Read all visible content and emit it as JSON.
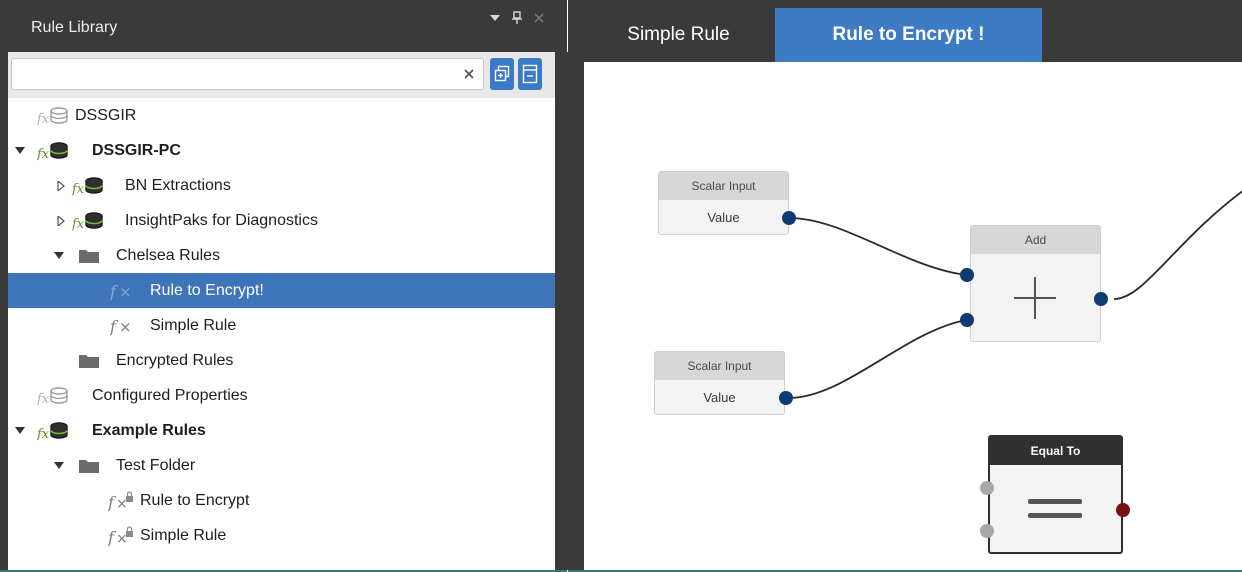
{
  "library": {
    "title": "Rule Library",
    "search": {
      "value": "",
      "placeholder": ""
    },
    "tree": [
      {
        "label": "DSSGIR",
        "icon": "function-database-icon",
        "bold": false
      },
      {
        "label": "DSSGIR-PC",
        "icon": "function-database-icon",
        "bold": true,
        "expanded": true
      },
      {
        "label": "BN Extractions",
        "icon": "function-database-icon",
        "bold": false,
        "expanded": false
      },
      {
        "label": "InsightPaks for Diagnostics",
        "icon": "function-database-icon",
        "bold": false,
        "expanded": false
      },
      {
        "label": "Chelsea Rules",
        "icon": "folder-icon",
        "bold": false,
        "expanded": true
      },
      {
        "label": "Rule to Encrypt!",
        "icon": "function-icon",
        "bold": false,
        "selected": true
      },
      {
        "label": "Simple Rule",
        "icon": "function-icon",
        "bold": false
      },
      {
        "label": "Encrypted Rules",
        "icon": "folder-icon",
        "bold": false
      },
      {
        "label": "Configured Properties",
        "icon": "function-database-icon",
        "bold": false
      },
      {
        "label": "Example Rules",
        "icon": "function-database-icon",
        "bold": true,
        "expanded": true
      },
      {
        "label": "Test Folder",
        "icon": "folder-icon",
        "bold": false,
        "expanded": true
      },
      {
        "label": "Rule to Encrypt",
        "icon": "locked-function-icon",
        "bold": false
      },
      {
        "label": "Simple Rule",
        "icon": "locked-function-icon",
        "bold": false
      }
    ]
  },
  "editor": {
    "tabs": [
      {
        "label": "Simple Rule",
        "active": false
      },
      {
        "label": "Rule to Encrypt !",
        "active": true
      }
    ],
    "canvas": {
      "scalar1": {
        "title": "Scalar Input",
        "value": "Value"
      },
      "scalar2": {
        "title": "Scalar Input",
        "value": "Value"
      },
      "add": {
        "title": "Add",
        "symbol": "+"
      },
      "equal": {
        "title": "Equal To",
        "symbol": "="
      }
    }
  },
  "colors": {
    "panel_bg": "#3a3a3a",
    "accent_blue": "#3e74b9",
    "port_blue": "#0f3a72",
    "port_red": "#7a1010"
  }
}
